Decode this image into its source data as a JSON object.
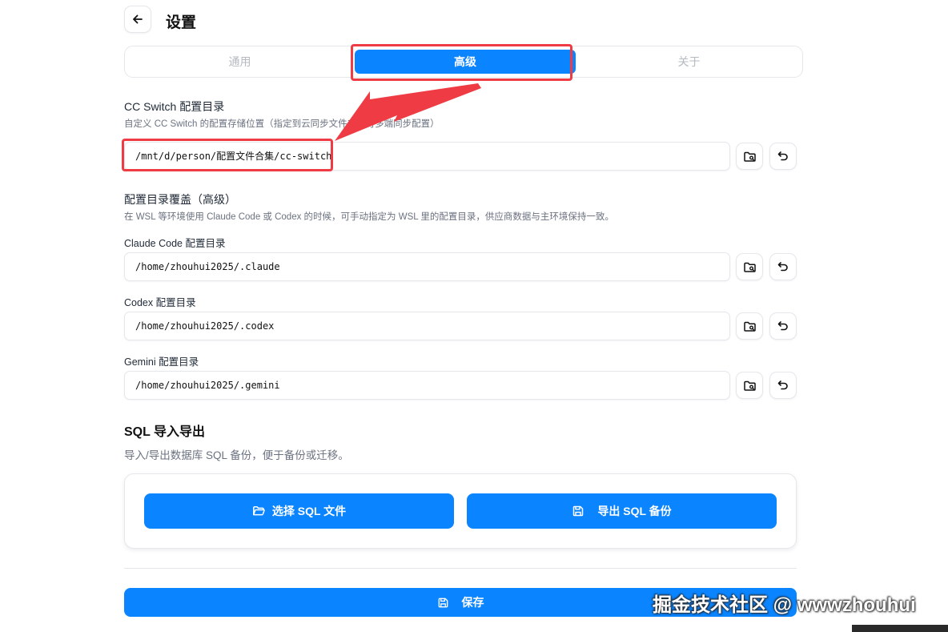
{
  "header": {
    "title": "设置"
  },
  "tabs": [
    {
      "label": "通用"
    },
    {
      "label": "高级"
    },
    {
      "label": "关于"
    }
  ],
  "config_dir": {
    "title": "CC Switch 配置目录",
    "description": "自定义 CC Switch 的配置存储位置（指定到云同步文件夹即可多端同步配置）",
    "value": "/mnt/d/person/配置文件合集/cc-switch"
  },
  "override": {
    "title": "配置目录覆盖（高级）",
    "description": "在 WSL 等环境使用 Claude Code 或 Codex 的时候，可手动指定为 WSL 里的配置目录，供应商数据与主环境保持一致。",
    "claude": {
      "label": "Claude Code 配置目录",
      "value": "/home/zhouhui2025/.claude"
    },
    "codex": {
      "label": "Codex 配置目录",
      "value": "/home/zhouhui2025/.codex"
    },
    "gemini": {
      "label": "Gemini 配置目录",
      "value": "/home/zhouhui2025/.gemini"
    }
  },
  "sql": {
    "title": "SQL 导入导出",
    "description": "导入/导出数据库 SQL 备份，便于备份或迁移。",
    "import_label": "选择 SQL 文件",
    "export_label": "导出 SQL 备份"
  },
  "footer": {
    "save_label": "保存"
  },
  "watermark": "掘金技术社区 @ wwwzhouhui",
  "colors": {
    "accent": "#0a84ff",
    "highlight": "#ef3b43"
  },
  "icons": {
    "back": "arrow-left-icon",
    "browse": "folder-search-icon",
    "reset": "undo-icon",
    "import": "folder-open-icon",
    "export": "save-icon",
    "save": "save-icon"
  }
}
